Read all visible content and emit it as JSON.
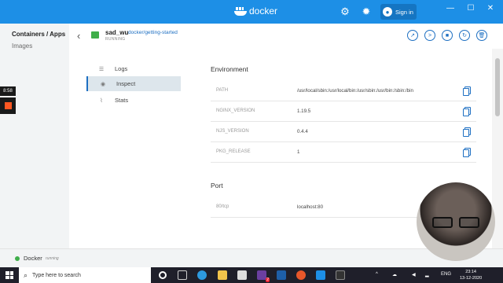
{
  "app": {
    "name": "docker"
  },
  "header": {
    "signin_label": "Sign in",
    "container_name": "sad_wu",
    "container_image": "docker/getting-started",
    "container_status": "RUNNING"
  },
  "sidebar": {
    "items": [
      {
        "label": "Containers / Apps"
      },
      {
        "label": "Images"
      }
    ]
  },
  "tabs": [
    {
      "label": "Logs"
    },
    {
      "label": "Inspect"
    },
    {
      "label": "Stats"
    }
  ],
  "environment": {
    "title": "Environment",
    "rows": [
      {
        "key": "PATH",
        "value": "/usr/local/sbin:/usr/local/bin:/usr/sbin:/usr/bin:/sbin:/bin"
      },
      {
        "key": "NGINX_VERSION",
        "value": "1.19.5"
      },
      {
        "key": "NJS_VERSION",
        "value": "0.4.4"
      },
      {
        "key": "PKG_RELEASE",
        "value": "1"
      }
    ]
  },
  "port": {
    "title": "Port",
    "rows": [
      {
        "key": "80/tcp",
        "value": "localhost:80"
      }
    ]
  },
  "statusbar": {
    "name": "Docker",
    "state": "running"
  },
  "recorder": {
    "time": "8:58"
  },
  "taskbar": {
    "search_placeholder": "Type here to search",
    "language": "ENG",
    "time": "23:14",
    "date": "13-12-2020",
    "badge_count": "2"
  },
  "colors": {
    "titlebar": "#1d8fe6",
    "accent": "#1d6fc2",
    "running": "#3fae4a"
  }
}
